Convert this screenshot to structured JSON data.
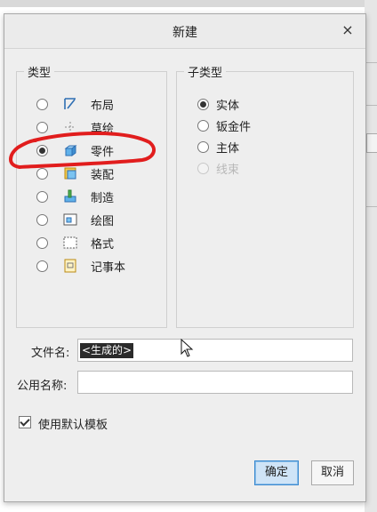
{
  "dialog": {
    "title": "新建",
    "close_glyph": "×"
  },
  "type_group": {
    "legend": "类型",
    "options": [
      {
        "label": "布局",
        "icon": "layout-icon",
        "selected": false
      },
      {
        "label": "草绘",
        "icon": "sketch-icon",
        "selected": false
      },
      {
        "label": "零件",
        "icon": "part-icon",
        "selected": true
      },
      {
        "label": "装配",
        "icon": "assembly-icon",
        "selected": false
      },
      {
        "label": "制造",
        "icon": "manufacturing-icon",
        "selected": false
      },
      {
        "label": "绘图",
        "icon": "drawing-icon",
        "selected": false
      },
      {
        "label": "格式",
        "icon": "format-icon",
        "selected": false
      },
      {
        "label": "记事本",
        "icon": "notebook-icon",
        "selected": false
      }
    ]
  },
  "subtype_group": {
    "legend": "子类型",
    "options": [
      {
        "label": "实体",
        "selected": true,
        "enabled": true
      },
      {
        "label": "钣金件",
        "selected": false,
        "enabled": true
      },
      {
        "label": "主体",
        "selected": false,
        "enabled": true
      },
      {
        "label": "线束",
        "selected": false,
        "enabled": false
      }
    ]
  },
  "filename": {
    "label": "文件名:",
    "value": "<生成的>"
  },
  "common_name": {
    "label": "公用名称:",
    "value": ""
  },
  "use_default_template": {
    "label": "使用默认模板",
    "checked": true
  },
  "buttons": {
    "ok": "确定",
    "cancel": "取消"
  },
  "colors": {
    "annotation_red": "#e11d1d",
    "primary_button": "#cfe4f7",
    "dialog_bg": "#eeeeee"
  }
}
